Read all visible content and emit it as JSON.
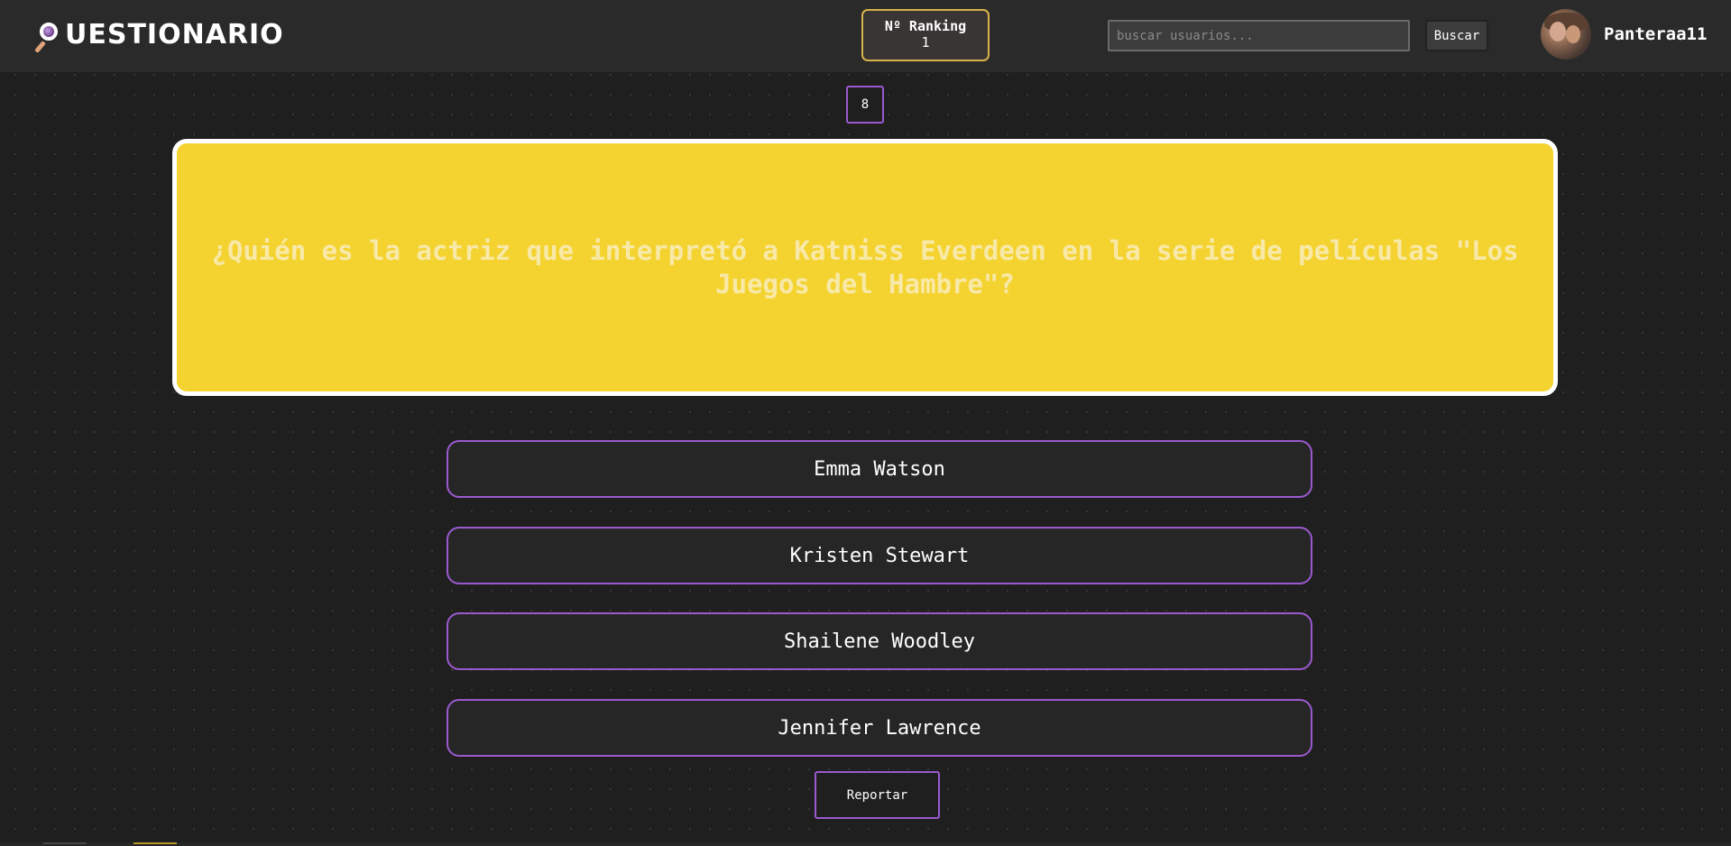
{
  "app": {
    "logo_text": "UESTIONARIO"
  },
  "header": {
    "ranking_label": "Nº Ranking",
    "ranking_value": "1",
    "search": {
      "placeholder": "buscar usuarios...",
      "value": "",
      "button_label": "Buscar"
    },
    "user": {
      "username": "Panteraa11"
    }
  },
  "quiz": {
    "counter": "8",
    "question": "¿Quién es la actriz que interpretó a Katniss Everdeen en la serie de películas \"Los Juegos del Hambre\"?",
    "answers": [
      {
        "label": "Emma Watson"
      },
      {
        "label": "Kristen Stewart"
      },
      {
        "label": "Shailene Woodley"
      },
      {
        "label": "Jennifer Lawrence"
      }
    ],
    "report_label": "Reportar"
  },
  "colors": {
    "background": "#1f1f1f",
    "topbar": "#2a2a2a",
    "accent_purple": "#9b59d0",
    "card_yellow": "#f4d330",
    "ranking_border": "#d8b24a"
  },
  "icons": {
    "logo_icon": "magnifying-glass-icon"
  }
}
